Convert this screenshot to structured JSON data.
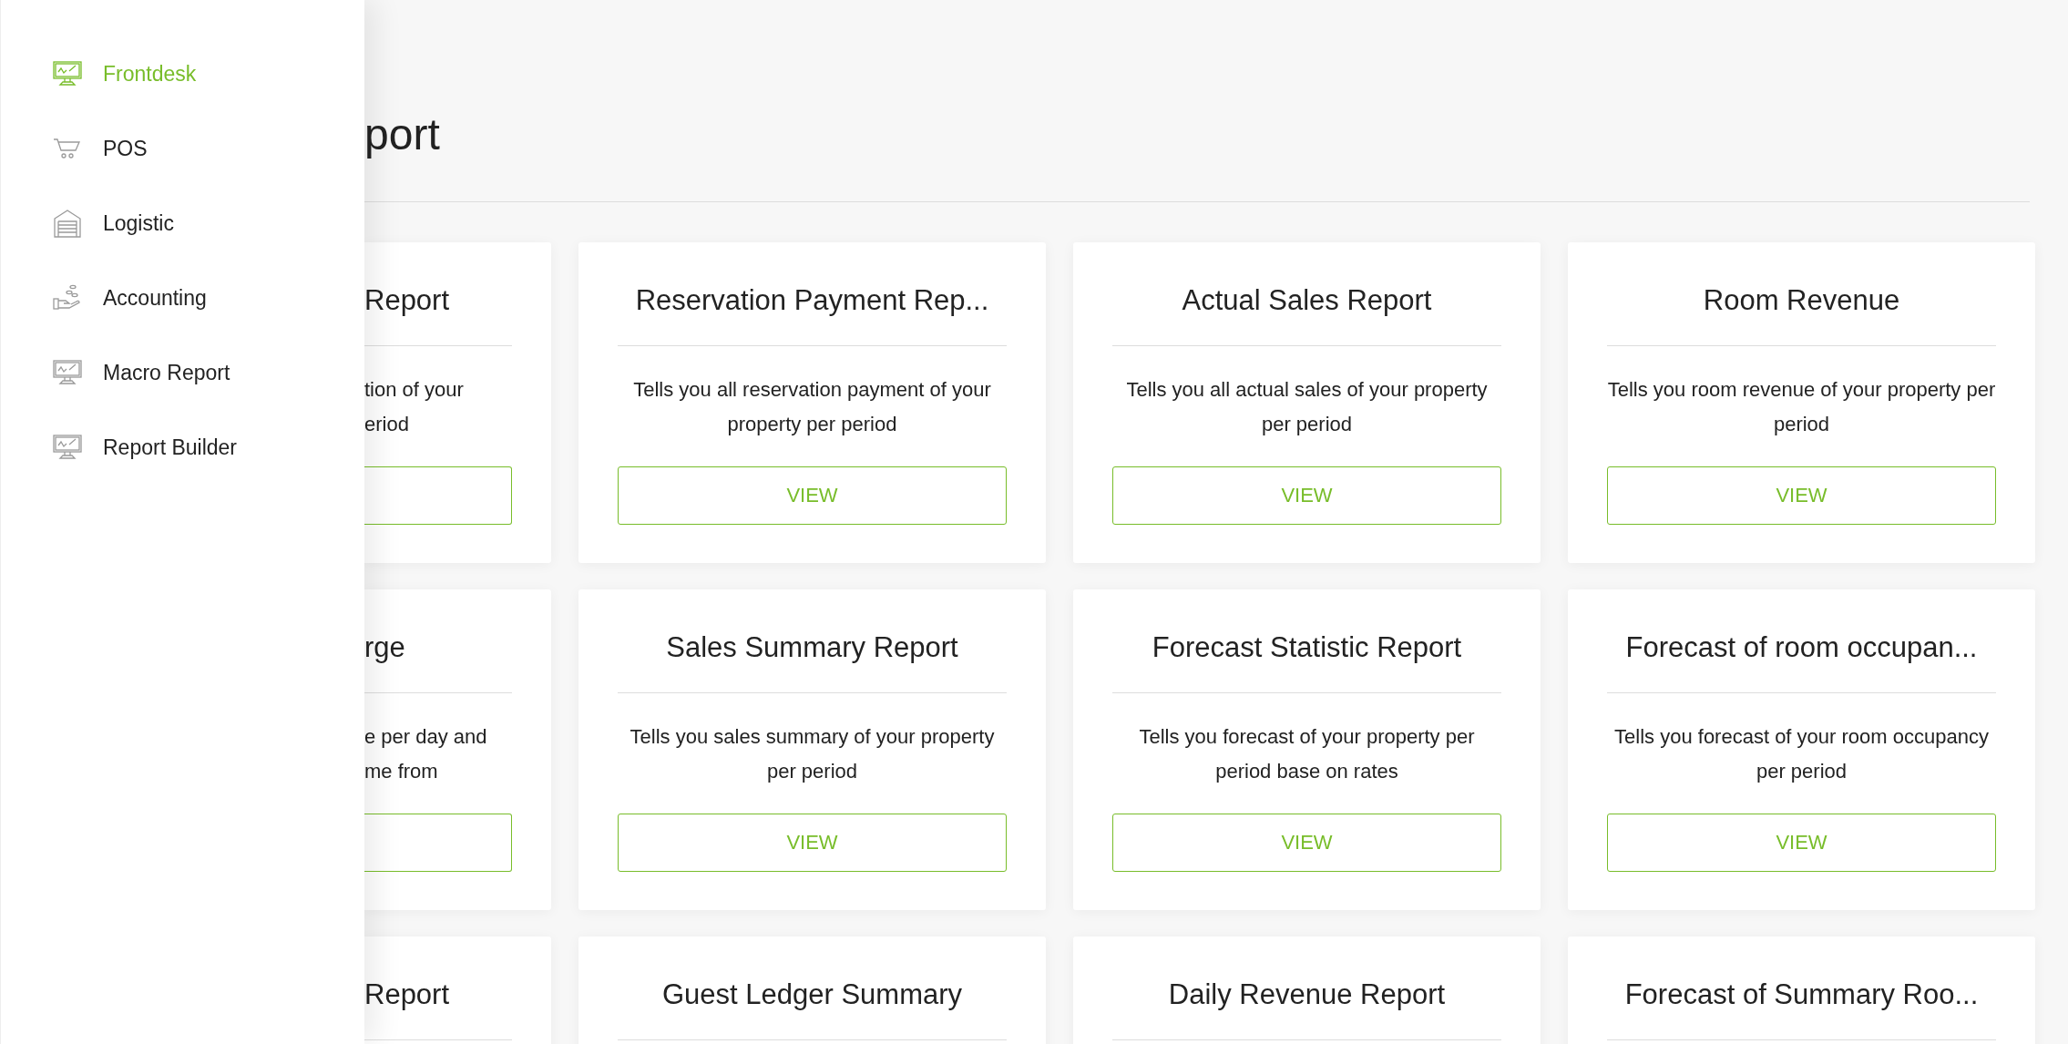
{
  "sidebar": {
    "items": [
      {
        "label": "Frontdesk",
        "selected": true
      },
      {
        "label": "POS",
        "selected": false
      },
      {
        "label": "Logistic",
        "selected": false
      },
      {
        "label": "Accounting",
        "selected": false
      },
      {
        "label": "Macro Report",
        "selected": false
      },
      {
        "label": "Report Builder",
        "selected": false
      }
    ]
  },
  "page": {
    "title": "port"
  },
  "cards": [
    {
      "kind": "partial",
      "title": "Report",
      "lines": [
        "tion of your",
        "eriod"
      ]
    },
    {
      "kind": "full",
      "title": "Reservation Payment Rep...",
      "description": "Tells you all reservation payment of your property per period",
      "button": "VIEW"
    },
    {
      "kind": "full",
      "title": "Actual Sales Report",
      "description": "Tells you all actual sales of your property per period",
      "button": "VIEW"
    },
    {
      "kind": "full",
      "title": "Room Revenue",
      "description": "Tells you room revenue of your property per period",
      "button": "VIEW"
    },
    {
      "kind": "partial",
      "title": "rge",
      "lines": [
        "e per day and",
        "me from"
      ]
    },
    {
      "kind": "full",
      "title": "Sales Summary Report",
      "description": "Tells you sales summary of your property per period",
      "button": "VIEW"
    },
    {
      "kind": "full",
      "title": "Forecast Statistic Report",
      "description": "Tells you forecast of your property per period base on rates",
      "button": "VIEW"
    },
    {
      "kind": "full",
      "title": "Forecast of room occupan...",
      "description": "Tells you forecast of your room occupancy per period",
      "button": "VIEW"
    },
    {
      "kind": "partial",
      "title": "Report"
    },
    {
      "kind": "full",
      "title": "Guest Ledger Summary"
    },
    {
      "kind": "full",
      "title": "Daily Revenue Report"
    },
    {
      "kind": "full",
      "title": "Forecast of Summary Roo..."
    }
  ]
}
